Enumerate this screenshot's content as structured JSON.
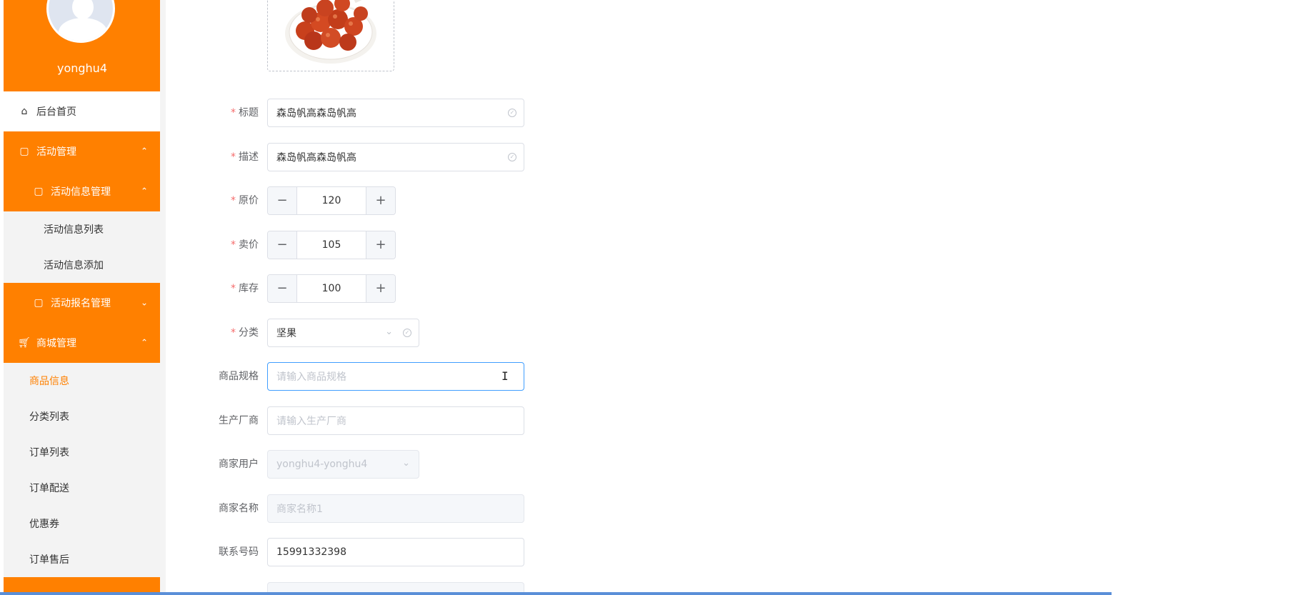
{
  "sidebar": {
    "username": "yonghu4",
    "items": [
      {
        "label": "后台首页",
        "icon": "home-icon"
      },
      {
        "label": "活动管理",
        "icon": "document-icon",
        "arrow": "up"
      },
      {
        "label": "活动信息管理",
        "icon": "document-icon",
        "arrow": "up"
      },
      {
        "label": "活动信息列表"
      },
      {
        "label": "活动信息添加"
      },
      {
        "label": "活动报名管理",
        "icon": "document-icon",
        "arrow": "down"
      },
      {
        "label": "商城管理",
        "icon": "cart-icon",
        "arrow": "up"
      },
      {
        "label": "商品信息",
        "active": true
      },
      {
        "label": "分类列表"
      },
      {
        "label": "订单列表"
      },
      {
        "label": "订单配送"
      },
      {
        "label": "优惠券"
      },
      {
        "label": "订单售后"
      }
    ]
  },
  "form": {
    "title": {
      "label": "标题",
      "required": true,
      "value": "森岛帆高森岛帆高"
    },
    "description": {
      "label": "描述",
      "required": true,
      "value": "森岛帆高森岛帆高"
    },
    "original_price": {
      "label": "原价",
      "required": true,
      "value": "120"
    },
    "sale_price": {
      "label": "卖价",
      "required": true,
      "value": "105"
    },
    "stock": {
      "label": "库存",
      "required": true,
      "value": "100"
    },
    "category": {
      "label": "分类",
      "required": true,
      "value": "坚果"
    },
    "spec": {
      "label": "商品规格",
      "placeholder": "请输入商品规格"
    },
    "manufacturer": {
      "label": "生产厂商",
      "placeholder": "请输入生产厂商"
    },
    "merchant_user": {
      "label": "商家用户",
      "value": "yonghu4-yonghu4"
    },
    "merchant_name": {
      "label": "商家名称",
      "value": "商家名称1"
    },
    "phone": {
      "label": "联系号码",
      "value": "15991332398"
    },
    "required_mark": "*",
    "minus": "−",
    "plus": "+"
  },
  "colors": {
    "accent": "#ff8000",
    "focus": "#409eff",
    "required": "#f56c6c"
  }
}
